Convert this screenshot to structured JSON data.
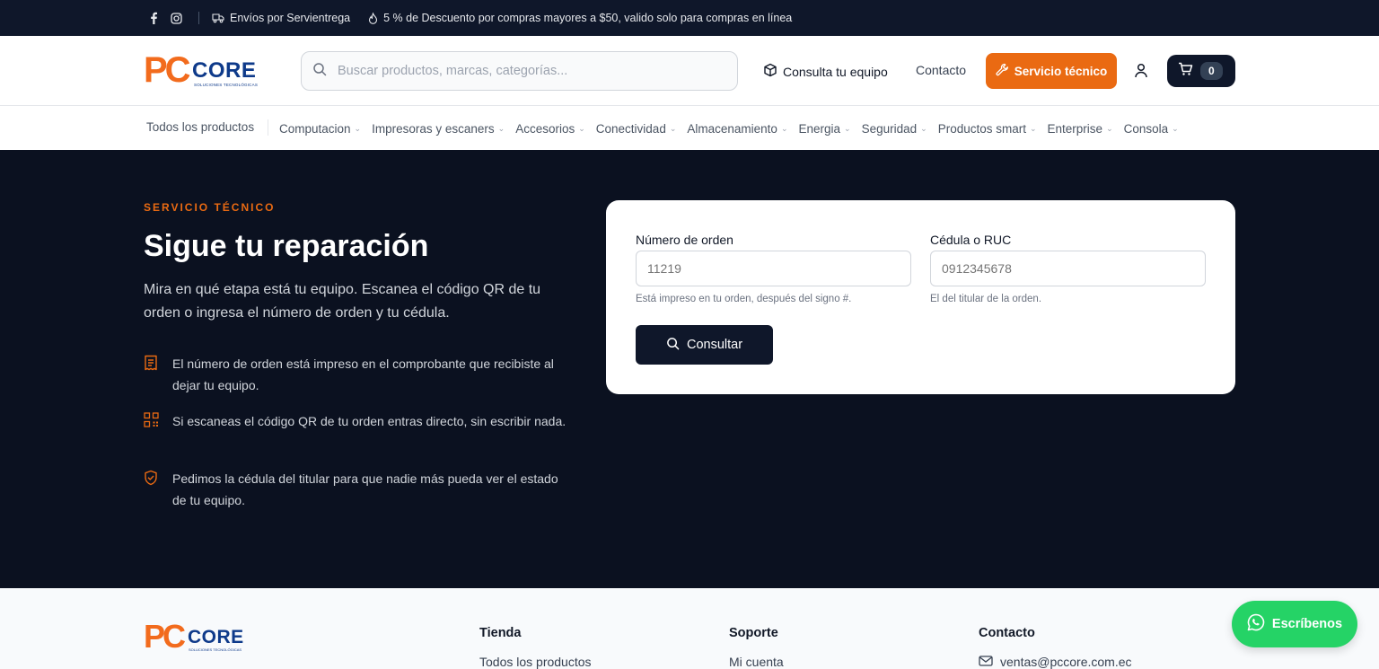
{
  "topbar": {
    "shipping": "Envíos por Servientrega",
    "discount": "5 % de Descuento por compras mayores a $50, valido solo para compras en línea"
  },
  "logo": {
    "pc": "PC",
    "core": "CORE",
    "tagline": "SOLUCIONES TECNOLÓGICAS"
  },
  "header": {
    "search_placeholder": "Buscar productos, marcas, categorías...",
    "check_equipment": "Consulta tu equipo",
    "contact": "Contacto",
    "service_button": "Servicio técnico",
    "cart_count": "0"
  },
  "nav": {
    "all_products": "Todos los productos",
    "categories": [
      "Computacion",
      "Impresoras y escaners",
      "Accesorios",
      "Conectividad",
      "Almacenamiento",
      "Energia",
      "Seguridad",
      "Productos smart",
      "Enterprise",
      "Consola"
    ]
  },
  "hero": {
    "eyebrow": "SERVICIO TÉCNICO",
    "title": "Sigue tu reparación",
    "description": "Mira en qué etapa está tu equipo. Escanea el código QR de tu orden o ingresa el número de orden y tu cédula.",
    "tips": [
      "El número de orden está impreso en el comprobante que recibiste al dejar tu equipo.",
      "Si escaneas el código QR de tu orden entras directo, sin escribir nada.",
      "Pedimos la cédula del titular para que nadie más pueda ver el estado de tu equipo."
    ]
  },
  "form": {
    "order_label": "Número de orden",
    "order_placeholder": "11219",
    "order_help": "Está impreso en tu orden, después del signo #.",
    "id_label": "Cédula o RUC",
    "id_placeholder": "0912345678",
    "id_help": "El del titular de la orden.",
    "submit": "Consultar"
  },
  "footer": {
    "store_heading": "Tienda",
    "store_link": "Todos los productos",
    "support_heading": "Soporte",
    "support_link": "Mi cuenta",
    "contact_heading": "Contacto",
    "email": "ventas@pccore.com.ec"
  },
  "whatsapp": "Escríbenos",
  "colors": {
    "accent": "#ea6a12",
    "navy": "#0f172a",
    "whatsapp": "#25d366"
  }
}
